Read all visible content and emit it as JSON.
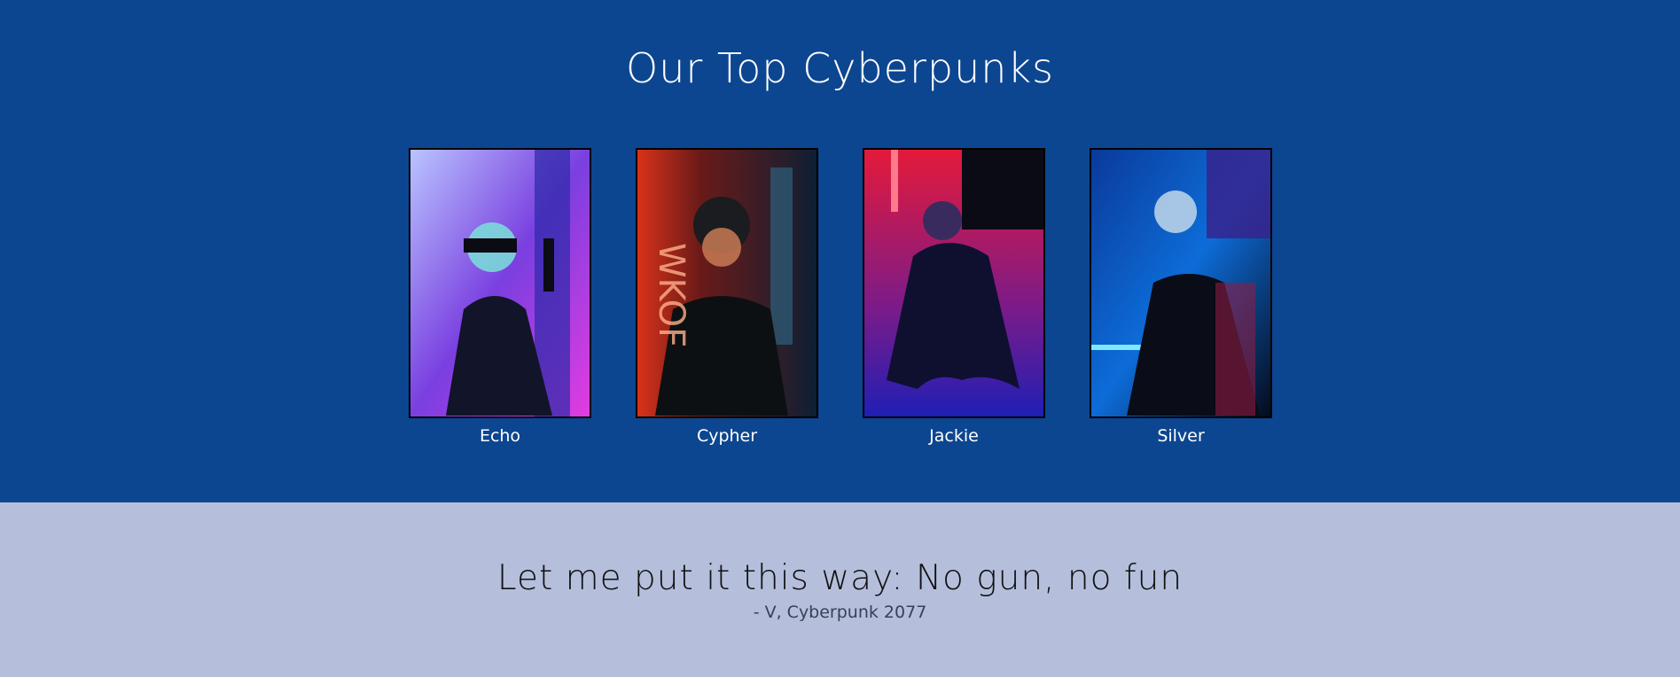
{
  "section_top": {
    "title": "Our Top Cyberpunks",
    "background": "#0d4690",
    "cards": [
      {
        "name": "Echo",
        "photo_palette": [
          "#c23cd7",
          "#3b7ad9",
          "#e94ee6"
        ]
      },
      {
        "name": "Cypher",
        "photo_palette": [
          "#d92b12",
          "#1a3e55",
          "#ff5a2a"
        ]
      },
      {
        "name": "Jackie",
        "photo_palette": [
          "#e0123a",
          "#1a1fa8",
          "#ff2040"
        ]
      },
      {
        "name": "Silver",
        "photo_palette": [
          "#0a57c9",
          "#5b2fb0",
          "#3fd0ff"
        ]
      }
    ]
  },
  "section_quote": {
    "background": "#b5bfdc",
    "quote": "Let me put it this way: No gun, no fun",
    "source": "- V, Cyberpunk 2077"
  }
}
